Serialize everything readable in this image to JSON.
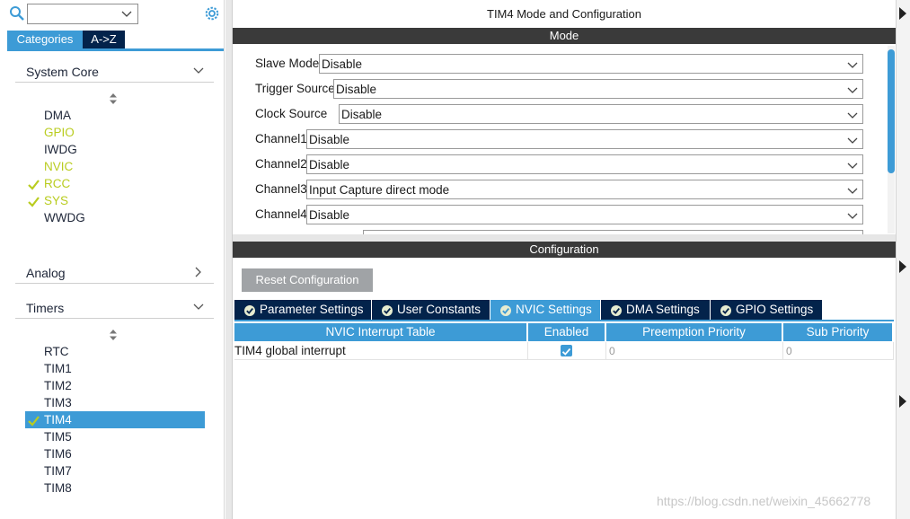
{
  "sidebar": {
    "search": {
      "value": "",
      "placeholder": ""
    },
    "tabs": {
      "categories": "Categories",
      "az": "A->Z"
    },
    "groups": {
      "system_core": {
        "label": "System Core",
        "items": [
          {
            "label": "DMA",
            "state": "normal"
          },
          {
            "label": "GPIO",
            "state": "warning"
          },
          {
            "label": "IWDG",
            "state": "normal"
          },
          {
            "label": "NVIC",
            "state": "warning"
          },
          {
            "label": "RCC",
            "state": "configured"
          },
          {
            "label": "SYS",
            "state": "configured"
          },
          {
            "label": "WWDG",
            "state": "normal"
          }
        ]
      },
      "analog": {
        "label": "Analog"
      },
      "timers": {
        "label": "Timers",
        "items": [
          {
            "label": "RTC",
            "state": "normal"
          },
          {
            "label": "TIM1",
            "state": "normal"
          },
          {
            "label": "TIM2",
            "state": "normal"
          },
          {
            "label": "TIM3",
            "state": "normal"
          },
          {
            "label": "TIM4",
            "state": "selected"
          },
          {
            "label": "TIM5",
            "state": "normal"
          },
          {
            "label": "TIM6",
            "state": "normal"
          },
          {
            "label": "TIM7",
            "state": "normal"
          },
          {
            "label": "TIM8",
            "state": "normal"
          }
        ]
      }
    }
  },
  "main": {
    "title": "TIM4 Mode and Configuration",
    "mode_header": "Mode",
    "mode_rows": [
      {
        "label": "Slave Mode",
        "value": "Disable"
      },
      {
        "label": "Trigger Source",
        "value": "Disable"
      },
      {
        "label": "Clock Source",
        "value": "Disable"
      },
      {
        "label": "Channel1",
        "value": "Disable"
      },
      {
        "label": "Channel2",
        "value": "Disable"
      },
      {
        "label": "Channel3",
        "value": "Input Capture direct mode"
      },
      {
        "label": "Channel4",
        "value": "Disable"
      }
    ],
    "config_header": "Configuration",
    "reset_button": "Reset Configuration",
    "config_tabs": [
      {
        "label": "Parameter Settings",
        "active": false
      },
      {
        "label": "User Constants",
        "active": false
      },
      {
        "label": "NVIC Settings",
        "active": true
      },
      {
        "label": "DMA Settings",
        "active": false
      },
      {
        "label": "GPIO Settings",
        "active": false
      }
    ],
    "nvic_table": {
      "columns": [
        "NVIC Interrupt Table",
        "Enabled",
        "Preemption Priority",
        "Sub Priority"
      ],
      "rows": [
        {
          "name": "TIM4 global interrupt",
          "enabled": true,
          "preemption": "0",
          "sub": "0"
        }
      ]
    }
  },
  "watermark": "https://blog.csdn.net/weixin_45662778",
  "colors": {
    "accent": "#3d9bd6",
    "navy": "#03234b",
    "warning": "#b9cc1f",
    "section_bar": "#3a3a3a"
  }
}
